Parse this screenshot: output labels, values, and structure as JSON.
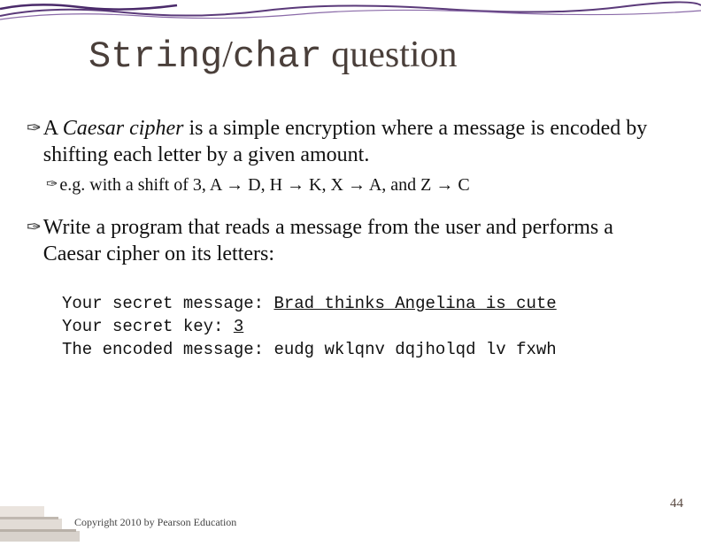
{
  "title": {
    "part1": "String",
    "slash": "/",
    "part2": "char",
    "rest": " question"
  },
  "bullets": {
    "b1_pre": "A ",
    "b1_em": "Caesar cipher",
    "b1_post": " is a simple encryption where a message is encoded by shifting each letter by a given amount.",
    "b1_sub": "e.g. with a shift of 3,   A → D,  H → K,  X → A,  and Z → C",
    "b2": "Write a program that reads a message from the user and performs a Caesar cipher on its letters:"
  },
  "code": {
    "l1_label": "Your secret message: ",
    "l1_val": "Brad thinks Angelina is cute",
    "l2_label": "Your secret key: ",
    "l2_val": "3",
    "l3_label": "The encoded message: ",
    "l3_val": "eudg wklqnv dqjholqd lv fxwh"
  },
  "footer": {
    "page": "44",
    "copyright": "Copyright 2010 by Pearson Education"
  }
}
